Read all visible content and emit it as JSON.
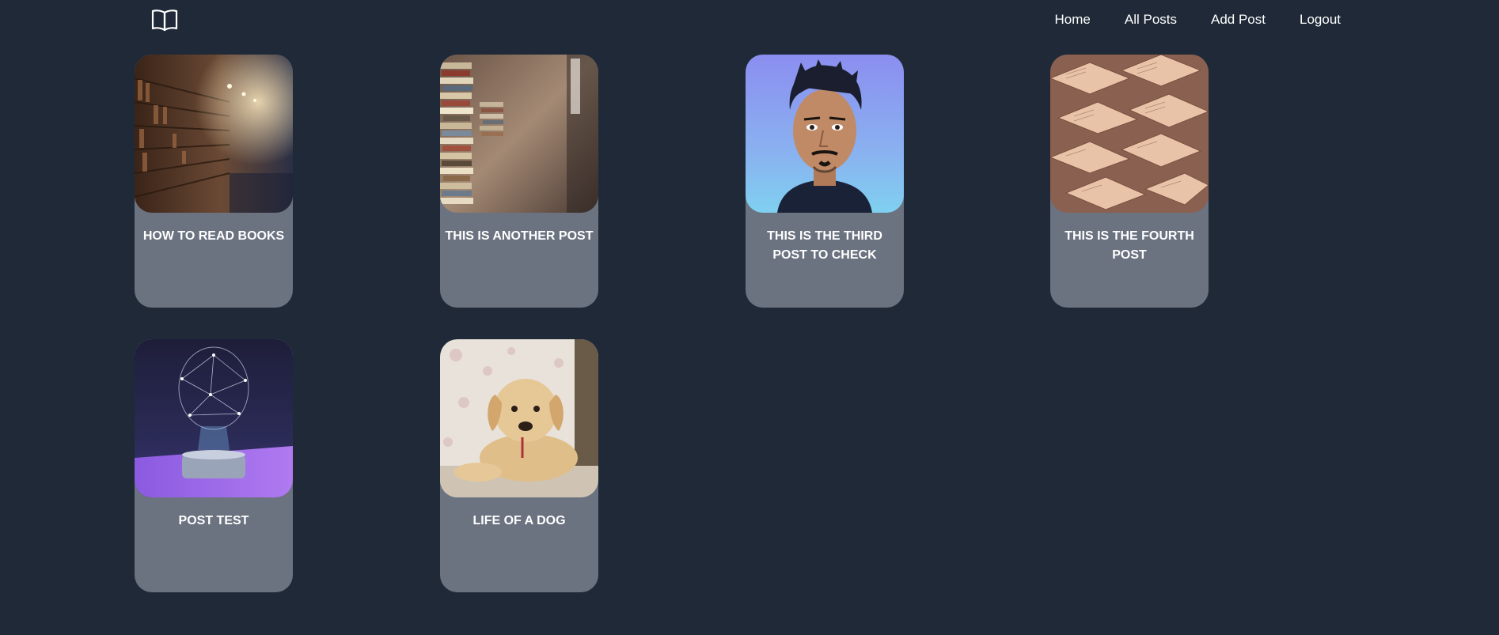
{
  "nav": {
    "logo_icon": "open-book-icon",
    "links": [
      {
        "label": "Home"
      },
      {
        "label": "All Posts"
      },
      {
        "label": "Add Post"
      },
      {
        "label": "Logout"
      }
    ]
  },
  "posts": [
    {
      "title": "HOW TO READ BOOKS",
      "image": "library-aisle-photo"
    },
    {
      "title": "THIS IS ANOTHER POST",
      "image": "book-stacks-photo"
    },
    {
      "title": "THIS IS THE THIRD POST TO CHECK",
      "image": "portrait-photo"
    },
    {
      "title": "THIS IS THE FOURTH POST",
      "image": "open-books-photo"
    },
    {
      "title": "POST TEST",
      "image": "ai-brain-hologram-photo"
    },
    {
      "title": "LIFE OF A DOG",
      "image": "puppy-photo"
    }
  ],
  "colors": {
    "background": "#1f2937",
    "card": "#6b7280",
    "text": "#ffffff"
  }
}
